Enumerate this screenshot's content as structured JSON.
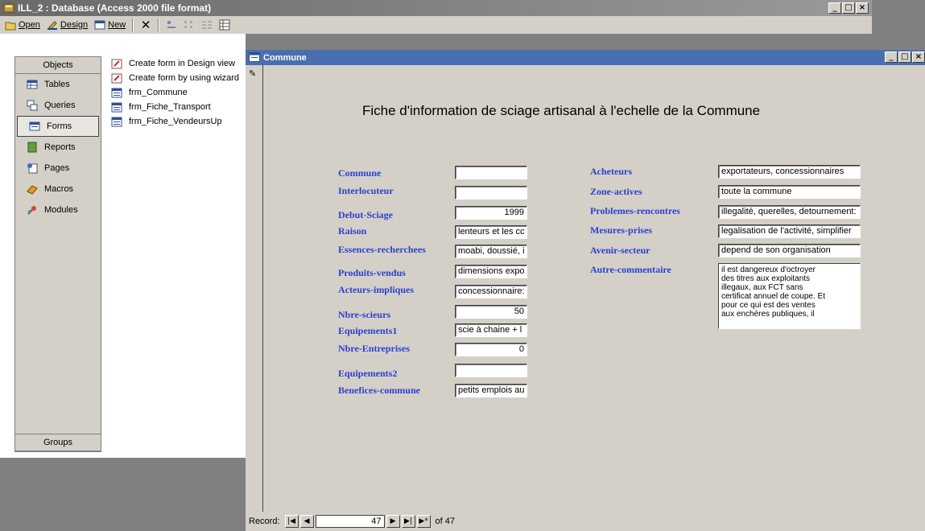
{
  "db_window": {
    "title": "ILL_2 : Database (Access 2000 file format)",
    "toolbar": {
      "open": "Open",
      "design": "Design",
      "new": "New"
    },
    "objects_header": "Objects",
    "objects": [
      {
        "label": "Tables",
        "icon": "table-icon"
      },
      {
        "label": "Queries",
        "icon": "query-icon"
      },
      {
        "label": "Forms",
        "icon": "form-icon",
        "selected": true
      },
      {
        "label": "Reports",
        "icon": "report-icon"
      },
      {
        "label": "Pages",
        "icon": "page-icon"
      },
      {
        "label": "Macros",
        "icon": "macro-icon"
      },
      {
        "label": "Modules",
        "icon": "module-icon"
      }
    ],
    "groups": "Groups",
    "list": [
      "Create form in Design view",
      "Create form by using wizard",
      "frm_Commune",
      "frm_Fiche_Transport",
      "frm_Fiche_VendeursUp"
    ]
  },
  "form": {
    "title": "Commune",
    "heading": "Fiche d'information de sciage artisanal à l'echelle de la Commune",
    "left_labels": [
      "Commune",
      "Interlocuteur",
      "Debut-Sciage",
      "Raison",
      "Essences-recherchees",
      "Produits-vendus",
      "Acteurs-impliques",
      "Nbre-scieurs",
      "Equipements1",
      "Nbre-Entreprises",
      "Equipements2",
      "Benefices-commune"
    ],
    "left_values": [
      "",
      "",
      "1999",
      "lenteurs et les cc",
      "moabi, doussié, i",
      "dimensions expo",
      "concessionnaire:",
      "50",
      "scie à chaine + l",
      "0",
      "",
      "petits emplois au"
    ],
    "right_labels": [
      "Acheteurs",
      "Zone-actives",
      "Problemes-rencontres",
      "Mesures-prises",
      "Avenir-secteur",
      "Autre-commentaire"
    ],
    "right_values": [
      "exportateurs, concessionnaires",
      "toute la commune",
      "illegalité, querelles, detournement:",
      "legalisation de l'activité, simplifier",
      "depend de son organisation"
    ],
    "memo_lines": [
      "il est dangereux d'octroyer",
      "des titres aux exploitants",
      "illegaux, aux FCT sans",
      "certificat annuel de coupe. Et",
      "pour ce qui est des ventes",
      "aux enchères publiques, il"
    ],
    "record": {
      "label": "Record:",
      "current": "47",
      "of_label": "of 47"
    }
  }
}
